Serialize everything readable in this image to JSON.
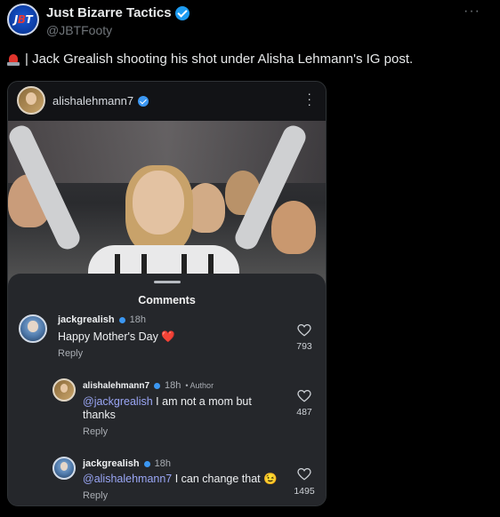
{
  "tweet": {
    "display_name": "Just Bizarre Tactics",
    "handle": "@JBTFooty",
    "avatar_text": "JBT",
    "text": "| Jack Grealish shooting his shot under Alisha Lehmann's IG post.",
    "more_icon": "more-horizontal-icon",
    "verified_color": "#1d9bf0"
  },
  "instagram": {
    "poster_username": "alishalehmann7",
    "sheet_title": "Comments",
    "comments": [
      {
        "username": "jackgrealish",
        "time": "18h",
        "text": "Happy Mother's Day",
        "emoji": "❤️",
        "reply_label": "Reply",
        "likes": "793"
      },
      {
        "username": "alishalehmann7",
        "time": "18h",
        "author_tag": "• Author",
        "mention": "@jackgrealish",
        "text": " I am not a mom but thanks",
        "reply_label": "Reply",
        "likes": "487"
      },
      {
        "username": "jackgrealish",
        "time": "18h",
        "mention": "@alishalehmann7",
        "text": " I can change that ",
        "emoji": "😉",
        "reply_label": "Reply",
        "likes": "1495"
      }
    ]
  },
  "colors": {
    "background": "#000000",
    "mention": "#9aa6f5",
    "heart_red": "#e0342c",
    "sheet": "#25272b"
  }
}
